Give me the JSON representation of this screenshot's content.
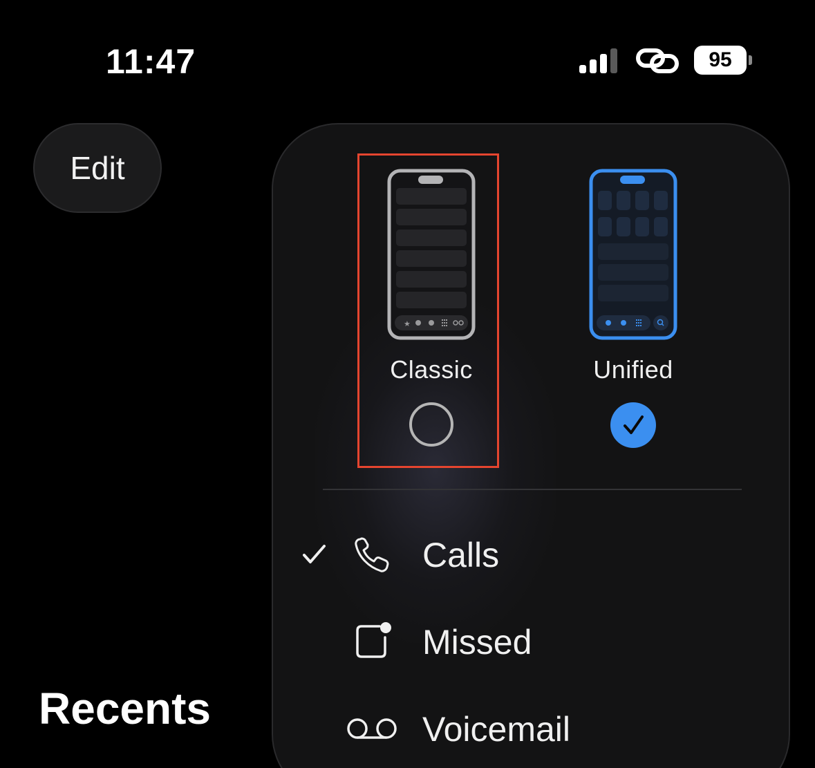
{
  "status_bar": {
    "time": "11:47",
    "battery": "95",
    "icons": [
      "cellular-signal-icon",
      "link-icon",
      "battery-icon"
    ]
  },
  "header": {
    "edit_label": "Edit",
    "title": "Recents"
  },
  "layout_menu": {
    "options": [
      {
        "label": "Classic",
        "selected": false,
        "highlighted": true
      },
      {
        "label": "Unified",
        "selected": true,
        "highlighted": false
      }
    ],
    "filters": [
      {
        "label": "Calls",
        "icon": "phone-icon",
        "checked": true
      },
      {
        "label": "Missed",
        "icon": "missed-call-icon",
        "checked": false
      },
      {
        "label": "Voicemail",
        "icon": "voicemail-icon",
        "checked": false
      }
    ]
  },
  "colors": {
    "accent": "#3b8ff0",
    "highlight_frame": "#e5452f",
    "panel_background": "#131314"
  }
}
